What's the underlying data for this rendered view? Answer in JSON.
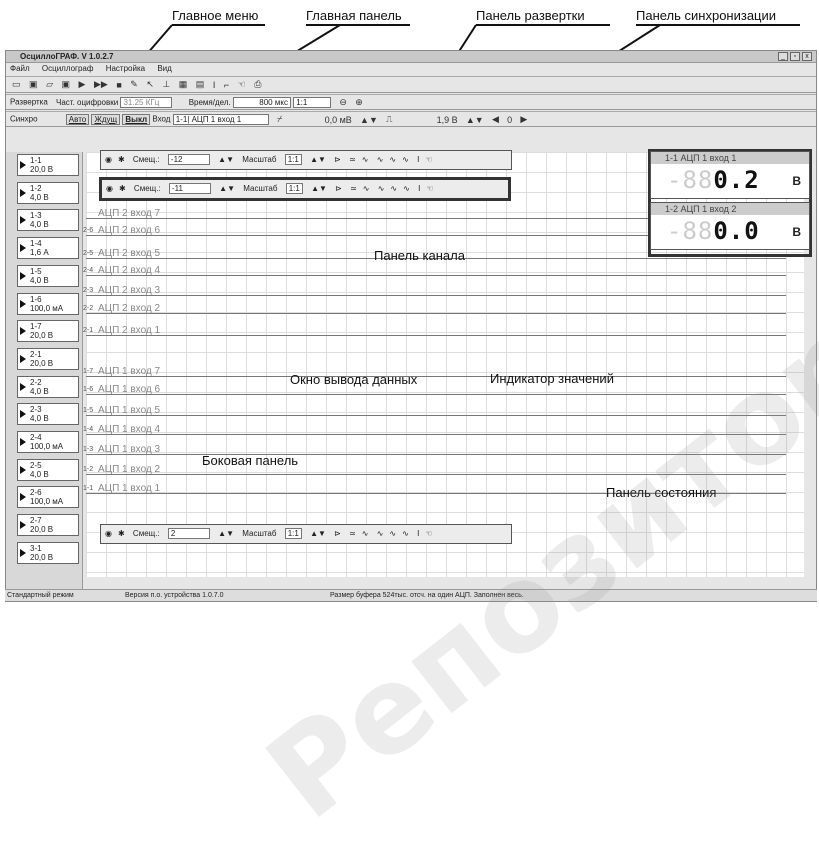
{
  "callouts": {
    "main_menu": "Главное меню",
    "main_panel": "Главная панель",
    "sweep_panel": "Панель развертки",
    "sync_panel": "Панель синхронизации",
    "channel_panel": "Панель канала",
    "output_window": "Окно вывода данных",
    "value_indicator": "Индикатор значений",
    "side_panel": "Боковая панель",
    "status_panel": "Панель состояния"
  },
  "watermark": "Репозиторий БГАТУ",
  "window": {
    "title": "ОсциллоГРАФ. V 1.0.2.7",
    "min": "_",
    "max": "▫",
    "close": "x"
  },
  "menu": [
    "Файл",
    "Осциллограф",
    "Настройка",
    "Вид"
  ],
  "sweep": {
    "label": "Развертка",
    "freq_label": "Част. оцифровки",
    "freq_value": "31.25 КГц",
    "time_label": "Время/дел.",
    "time_value": "800 мкс",
    "scale_value": "1:1"
  },
  "sync": {
    "label": "Синхро",
    "auto": "Авто",
    "wait": "Ждущ",
    "off": "Выкл",
    "input_label": "Вход",
    "input_value": "1-1| АЦП 1 вход 1",
    "level": "0,0 мВ",
    "level2": "1,9 В",
    "count": "0"
  },
  "side": [
    {
      "id": "1-1",
      "v": "20,0 В"
    },
    {
      "id": "1-2",
      "v": "4,0 В"
    },
    {
      "id": "1-3",
      "v": "4,0 В"
    },
    {
      "id": "1-4",
      "v": "1,6 А"
    },
    {
      "id": "1-5",
      "v": "4,0 В"
    },
    {
      "id": "1-6",
      "v": "100,0 мА"
    },
    {
      "id": "1-7",
      "v": "20,0 В"
    },
    {
      "id": "2-1",
      "v": "20,0 В"
    },
    {
      "id": "2-2",
      "v": "4,0 В"
    },
    {
      "id": "2-3",
      "v": "4,0 В"
    },
    {
      "id": "2-4",
      "v": "100,0 мА"
    },
    {
      "id": "2-5",
      "v": "4,0 В"
    },
    {
      "id": "2-6",
      "v": "100,0 мА"
    },
    {
      "id": "2-7",
      "v": "20,0 В"
    },
    {
      "id": "3-1",
      "v": "20,0 В"
    }
  ],
  "channel_panels": [
    {
      "offset_label": "Смещ.:",
      "offset": "-12",
      "scale_label": "Масштаб",
      "scale": "1:1"
    },
    {
      "offset_label": "Смещ.:",
      "offset": "-11",
      "scale_label": "Масштаб",
      "scale": "1:1"
    },
    {
      "offset_label": "Смещ.:",
      "offset": "2",
      "scale_label": "Масштаб",
      "scale": "1:1"
    }
  ],
  "traces": [
    "АЦП 2 вход 7",
    "АЦП 2 вход 6",
    "АЦП 2 вход 5",
    "АЦП 2 вход 4",
    "АЦП 2 вход 3",
    "АЦП 2 вход 2",
    "АЦП 2 вход 1",
    "АЦП 1 вход 7",
    "АЦП 1 вход 6",
    "АЦП 1 вход 5",
    "АЦП 1 вход 4",
    "АЦП 1 вход 3",
    "АЦП 1 вход 2",
    "АЦП 1 вход 1"
  ],
  "trace_nums": [
    "2-6",
    "2-5",
    "2-4",
    "2-3",
    "2-2",
    "2-1",
    "1-7",
    "1-6",
    "1-5",
    "1-4",
    "1-3",
    "1-2",
    "1-1"
  ],
  "indicators": [
    {
      "title": "1-1 АЦП 1 вход 1",
      "ghost": "-88",
      "value": "0.2",
      "unit": "В"
    },
    {
      "title": "1-2 АЦП 1 вход 2",
      "ghost": "-88",
      "value": "0.0",
      "unit": "В"
    }
  ],
  "status": {
    "mode": "Стандартный режим",
    "version": "Версия п.о. устройства 1.0.7.0",
    "buffer": "Размер буфера 524тыс. отсч. на один АЦП. Заполнен весь."
  }
}
